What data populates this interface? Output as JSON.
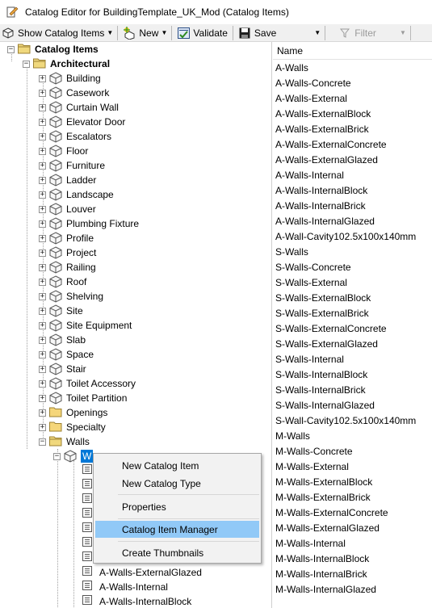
{
  "window": {
    "title": "Catalog Editor for BuildingTemplate_UK_Mod (Catalog Items)"
  },
  "toolbar": {
    "show_label": "Show Catalog Items",
    "new_label": "New",
    "validate_label": "Validate",
    "save_label": "Save",
    "filter_label": "Filter"
  },
  "tree": {
    "root_label": "Catalog Items",
    "architectural_label": "Architectural",
    "categories": [
      "Building",
      "Casework",
      "Curtain Wall",
      "Elevator Door",
      "Escalators",
      "Floor",
      "Furniture",
      "Ladder",
      "Landscape",
      "Louver",
      "Plumbing Fixture",
      "Profile",
      "Project",
      "Railing",
      "Roof",
      "Shelving",
      "Site",
      "Site Equipment",
      "Slab",
      "Space",
      "Stair",
      "Toilet Accessory",
      "Toilet Partition"
    ],
    "folders": [
      "Openings",
      "Specialty",
      "Walls"
    ],
    "selected_label": "W",
    "children": [
      "",
      "",
      "",
      "",
      "",
      "",
      "",
      "A-Walls-ExternalGlazed",
      "A-Walls-Internal",
      "A-Walls-InternalBlock"
    ]
  },
  "list": {
    "header": "Name",
    "items": [
      "A-Walls",
      "A-Walls-Concrete",
      "A-Walls-External",
      "A-Walls-ExternalBlock",
      "A-Walls-ExternalBrick",
      "A-Walls-ExternalConcrete",
      "A-Walls-ExternalGlazed",
      "A-Walls-Internal",
      "A-Walls-InternalBlock",
      "A-Walls-InternalBrick",
      "A-Walls-InternalGlazed",
      "A-Wall-Cavity102.5x100x140mm",
      "S-Walls",
      "S-Walls-Concrete",
      "S-Walls-External",
      "S-Walls-ExternalBlock",
      "S-Walls-ExternalBrick",
      "S-Walls-ExternalConcrete",
      "S-Walls-ExternalGlazed",
      "S-Walls-Internal",
      "S-Walls-InternalBlock",
      "S-Walls-InternalBrick",
      "S-Walls-InternalGlazed",
      "S-Wall-Cavity102.5x100x140mm",
      "M-Walls",
      "M-Walls-Concrete",
      "M-Walls-External",
      "M-Walls-ExternalBlock",
      "M-Walls-ExternalBrick",
      "M-Walls-ExternalConcrete",
      "M-Walls-ExternalGlazed",
      "M-Walls-Internal",
      "M-Walls-InternalBlock",
      "M-Walls-InternalBrick",
      "M-Walls-InternalGlazed"
    ]
  },
  "context_menu": {
    "items": [
      "New Catalog Item",
      "New Catalog Type",
      "Properties",
      "Catalog Item Manager",
      "Create Thumbnails"
    ],
    "highlighted": "Catalog Item Manager"
  },
  "colors": {
    "highlight": "#91c9f7",
    "selection": "#0078d7",
    "folder": "#f5d67a"
  }
}
